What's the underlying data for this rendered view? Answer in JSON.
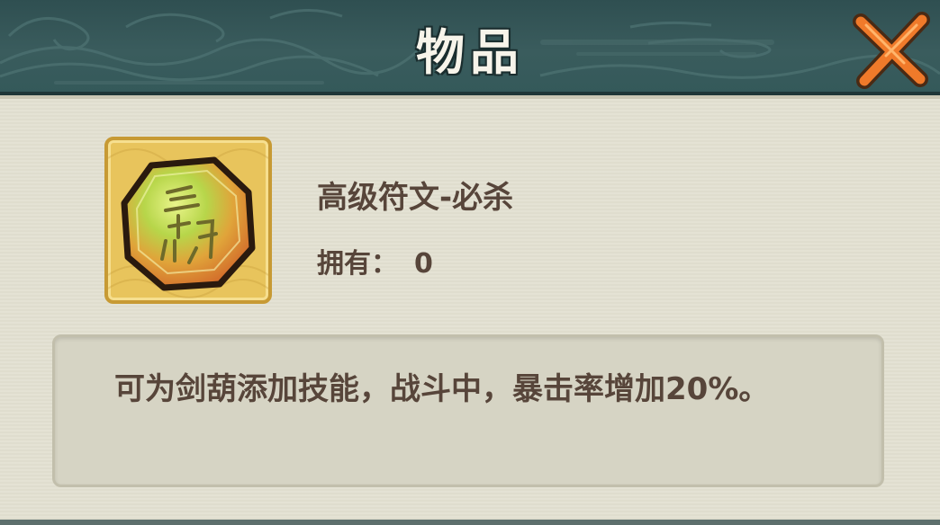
{
  "dialog": {
    "title": "物品",
    "close_icon": "close-x-icon"
  },
  "item": {
    "icon": "rune-stone-icon",
    "name": "高级符文-必杀",
    "owned_label": "拥有：",
    "owned_count": "0",
    "description": "可为剑葫添加技能，战斗中，暴击率增加20%。"
  },
  "colors": {
    "header_bg": "#34595a",
    "panel_bg": "#e3e1d2",
    "text": "#57453a",
    "close_orange": "#f07a2a",
    "icon_frame": "#e8c45c"
  }
}
